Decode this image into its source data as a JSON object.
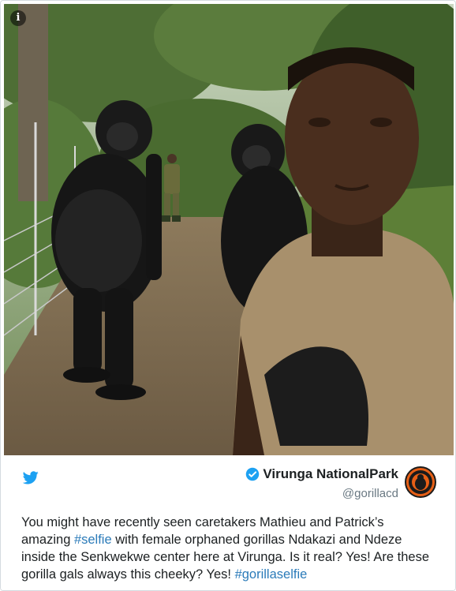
{
  "tweet": {
    "account": {
      "display_name": "Virunga NationalPark",
      "handle": "@gorillacd",
      "verified": true
    },
    "text_parts": [
      {
        "text": "You might have recently seen caretakers Mathieu and Patrick’s amazing ",
        "type": "text"
      },
      {
        "text": "#selfie",
        "type": "hashtag"
      },
      {
        "text": " with female orphaned gorillas Ndakazi and Ndeze inside the Senkwekwe center here at Virunga. Is it real? Yes! Are these gorilla gals always this cheeky? Yes! ",
        "type": "text"
      },
      {
        "text": "#gorillaselfie",
        "type": "hashtag"
      }
    ],
    "icons": {
      "info": "info-icon",
      "platform": "twitter-bird-icon",
      "verified": "verified-badge-icon"
    }
  },
  "photo": {
    "description_icon": "info-icon"
  },
  "colors": {
    "hashtag": "#2b7bb9",
    "twitter_blue": "#1da1f2",
    "name": "#1c2022",
    "handle": "#697882",
    "avatar_bg": "#e65f16"
  }
}
